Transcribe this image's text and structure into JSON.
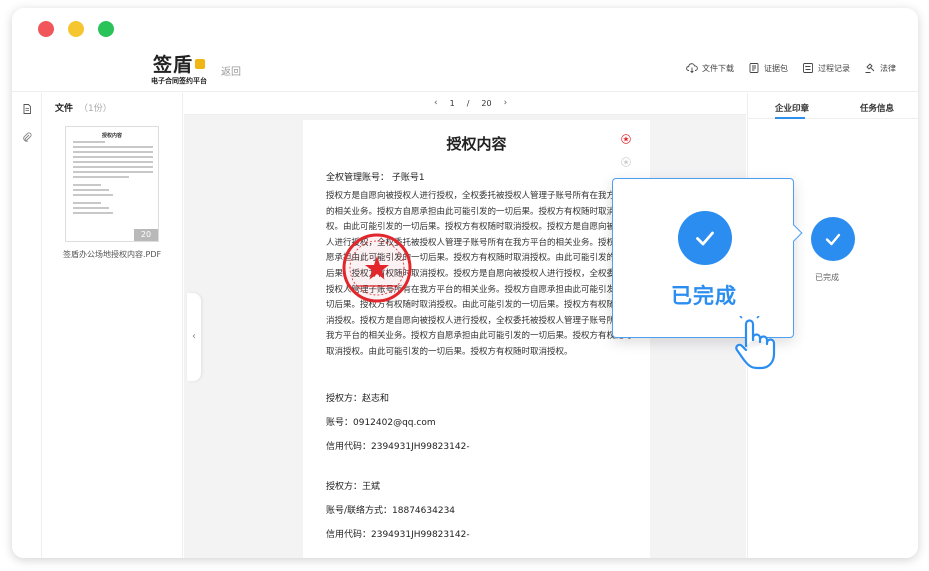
{
  "app": {
    "logo_text": "签盾",
    "logo_subtitle": "电子合同签约平台",
    "back_label": "返回",
    "accent_color": "#2b8def"
  },
  "toolbar": {
    "actions": [
      {
        "label": "文件下载",
        "icon": "cloud-download-icon"
      },
      {
        "label": "证据包",
        "icon": "evidence-package-icon"
      },
      {
        "label": "过程记录",
        "icon": "process-record-icon"
      },
      {
        "label": "法律",
        "icon": "law-gavel-icon"
      }
    ]
  },
  "rail": {
    "icons": [
      "document-icon",
      "paperclip-icon"
    ]
  },
  "files": {
    "header": "文件",
    "count": "（1份）",
    "items": [
      {
        "thumb_title": "授权内容",
        "page_count": "20",
        "name": "签盾办公场地授权内容.PDF"
      }
    ]
  },
  "pager": {
    "current": "1",
    "separator": "/",
    "total": "20"
  },
  "document": {
    "title": "授权内容",
    "account_line": "全权管理账号：  子账号1",
    "body": "授权方是自愿向被授权人进行授权，全权委托被授权人管理子账号所有在我方平台的相关业务。授权方自愿承担由此可能引发的一切后果。授权方有权随时取消授权。由此可能引发的一切后果。授权方有权随时取消授权。授权方是自愿向被授权人进行授权，全权委托被授权人管理子账号所有在我方平台的相关业务。授权方自愿承担由此可能引发的一切后果。授权方有权随时取消授权。由此可能引发的一切后果。授权方有权随时取消授权。授权方是自愿向被授权人进行授权，全权委托被授权人管理子账号所有在我方平台的相关业务。授权方自愿承担由此可能引发的一切后果。授权方有权随时取消授权。由此可能引发的一切后果。授权方有权随时取消授权。授权方是自愿向被授权人进行授权，全权委托被授权人管理子账号所有在我方平台的相关业务。授权方自愿承担由此可能引发的一切后果。授权方有权随时取消授权。由此可能引发的一切后果。授权方有权随时取消授权。",
    "party1_name": "授权方：赵志和",
    "party1_account": "账号：0912402@qq.com",
    "party1_code": "信用代码：2394931JH99823142-",
    "party2_name": "授权方：王斌",
    "party2_account": "账号/联络方式：18874634234",
    "party2_code": "信用代码：2394931JH99823142-",
    "seal_color": "#e2262b"
  },
  "right_panel": {
    "tab_seal": "企业印章",
    "tab_task": "任务信息",
    "status_label": "已完成"
  },
  "popup": {
    "text": "已完成"
  }
}
